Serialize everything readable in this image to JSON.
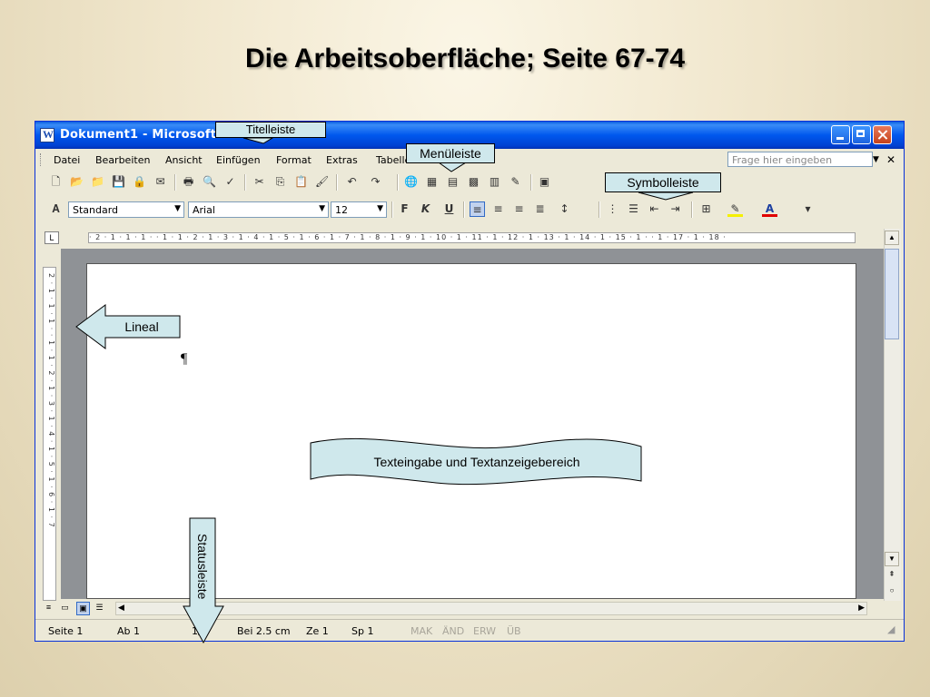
{
  "slide_title": "Die Arbeitsoberfläche; Seite 67-74",
  "window": {
    "title": "Dokument1 - Microsoft Word",
    "menu": [
      "Datei",
      "Bearbeiten",
      "Ansicht",
      "Einfügen",
      "Format",
      "Extras",
      "Tabelle"
    ],
    "help_placeholder": "Frage hier eingeben",
    "formatting": {
      "style": "Standard",
      "font": "Arial",
      "size": "12",
      "bold": "F",
      "italic": "K",
      "underline": "U"
    },
    "ruler_text": "· 2 · 1 · 1 · 1 ·   · 1 · 1 · 2 · 1 · 3 · 1 · 4 · 1 · 5 · 1 · 6 · 1 · 7 · 1 · 8 · 1 · 9 · 1 · 10 · 1 · 11 · 1 · 12 · 1 · 13 · 1 · 14 · 1 · 15 · 1 ·   · 1 · 17 · 1 · 18 ·",
    "vruler_text": "2 · 1 · 1 · 1 ·   · 1 · 1 · 2 · 1 · 3 · 1 · 4 · 1 · 5 · 1 · 6 · 1 · 7",
    "pilcrow": "¶",
    "tab_selector": "L",
    "status": {
      "page": "Seite  1",
      "section": "Ab  1",
      "of": "1/",
      "position": "Bei  2.5 cm",
      "line": "Ze  1",
      "column": "Sp  1",
      "mak": "MAK",
      "and": "ÄND",
      "erw": "ERW",
      "ub": "ÜB"
    }
  },
  "callouts": {
    "titelleiste": "Titelleiste",
    "menueleiste": "Menüleiste",
    "symbolleiste": "Symbolleiste",
    "lineal": "Lineal",
    "texteingabe": "Texteingabe und Textanzeigebereich",
    "statusleiste": "Statusleiste"
  },
  "colors": {
    "callout_fill": "#cfe8ec",
    "titlebar": "#0058ee",
    "window_bg": "#ece9d8"
  }
}
